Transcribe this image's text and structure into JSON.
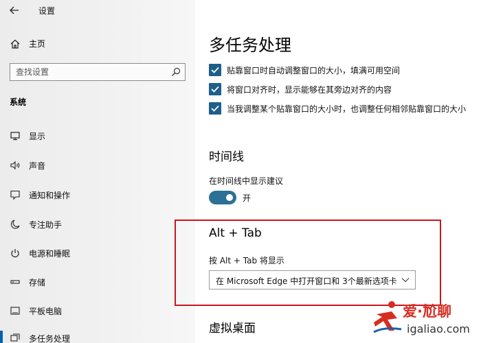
{
  "window": {
    "title": "设置"
  },
  "sidebar": {
    "home_label": "主页",
    "search_placeholder": "查找设置",
    "section_title": "系统",
    "items": [
      {
        "label": "显示",
        "icon": "monitor-icon"
      },
      {
        "label": "声音",
        "icon": "speaker-icon"
      },
      {
        "label": "通知和操作",
        "icon": "notification-icon"
      },
      {
        "label": "专注助手",
        "icon": "moon-icon"
      },
      {
        "label": "电源和睡眠",
        "icon": "power-icon"
      },
      {
        "label": "存储",
        "icon": "storage-icon"
      },
      {
        "label": "平板电脑",
        "icon": "tablet-icon"
      },
      {
        "label": "多任务处理",
        "icon": "multitasking-icon",
        "selected": true
      }
    ]
  },
  "main": {
    "title": "多任务处理",
    "snap_options": [
      {
        "label": "贴靠窗口时自动调整窗口的大小，填满可用空间",
        "checked": true
      },
      {
        "label": "将窗口对齐时，显示能够在其旁边对齐的内容",
        "checked": true
      },
      {
        "label": "当我调整某个贴靠窗口的大小时，也调整任何相邻贴靠窗口的大小",
        "checked": true
      }
    ],
    "timeline": {
      "title": "时间线",
      "option_label": "在时间线中显示建议",
      "toggle_on": true,
      "toggle_label": "开"
    },
    "alttab": {
      "title": "Alt + Tab",
      "label": "按 Alt + Tab 将显示",
      "selected": "在 Microsoft Edge 中打开窗口和 3个最新选项卡"
    },
    "virtual_desktops": {
      "title": "虚拟桌面"
    }
  },
  "colors": {
    "accent": "#0063b1",
    "checkbox": "#1e5f8a",
    "toggle": "#2c6f97",
    "highlight": "#c8151d"
  },
  "watermark": {
    "text1": "爱·尬聊",
    "text2": "igaliao.com"
  }
}
